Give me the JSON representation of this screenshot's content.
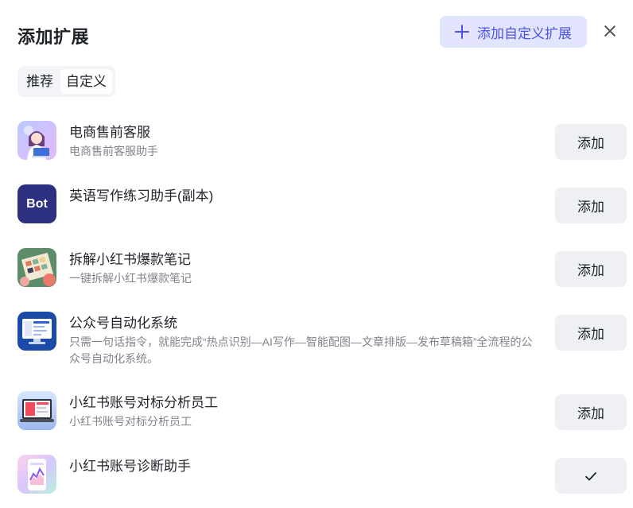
{
  "dialog": {
    "title": "添加扩展",
    "add_custom_label": "添加自定义扩展"
  },
  "tabs": [
    {
      "label": "推荐",
      "active": false
    },
    {
      "label": "自定义",
      "active": true
    }
  ],
  "items": [
    {
      "name": "电商售前客服",
      "desc": "电商售前客服助手",
      "action": "添加",
      "added": false,
      "icon": "anime-girl-laptop-icon"
    },
    {
      "name": "英语写作练习助手(副本)",
      "desc": "",
      "action": "添加",
      "added": false,
      "icon": "bot-icon",
      "icon_text": "Bot"
    },
    {
      "name": "拆解小红书爆款笔记",
      "desc": "一键拆解小红书爆款笔记",
      "action": "添加",
      "added": false,
      "icon": "notes-collage-icon"
    },
    {
      "name": "公众号自动化系统",
      "desc": "只需一句话指令，就能完成“热点识别—AI写作—智能配图—文章排版—发布草稿箱”全流程的公众号自动化系统。",
      "action": "添加",
      "added": false,
      "icon": "monitor-dashboard-icon"
    },
    {
      "name": "小红书账号对标分析员工",
      "desc": "小红书账号对标分析员工",
      "action": "添加",
      "added": false,
      "icon": "laptop-red-screen-icon"
    },
    {
      "name": "小红书账号诊断助手",
      "desc": "",
      "action": "✓",
      "added": true,
      "icon": "phone-chart-icon"
    }
  ]
}
